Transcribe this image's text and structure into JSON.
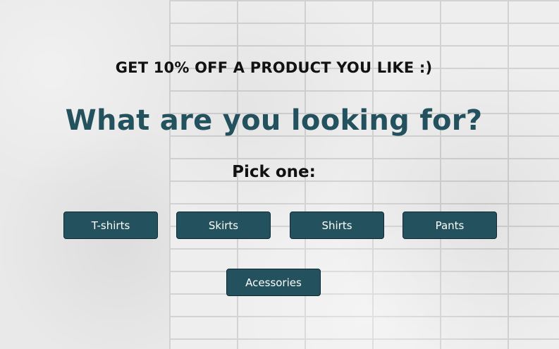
{
  "promo_text": "GET 10% OFF A PRODUCT YOU LIKE :)",
  "headline": "What are you looking for?",
  "prompt": "Pick one:",
  "categories": [
    {
      "label": "T-shirts"
    },
    {
      "label": "Skirts"
    },
    {
      "label": "Shirts"
    },
    {
      "label": "Pants"
    },
    {
      "label": "Acessories"
    }
  ],
  "colors": {
    "accent": "#23525e",
    "button_text": "#ffffff",
    "heading_text": "#111111"
  }
}
